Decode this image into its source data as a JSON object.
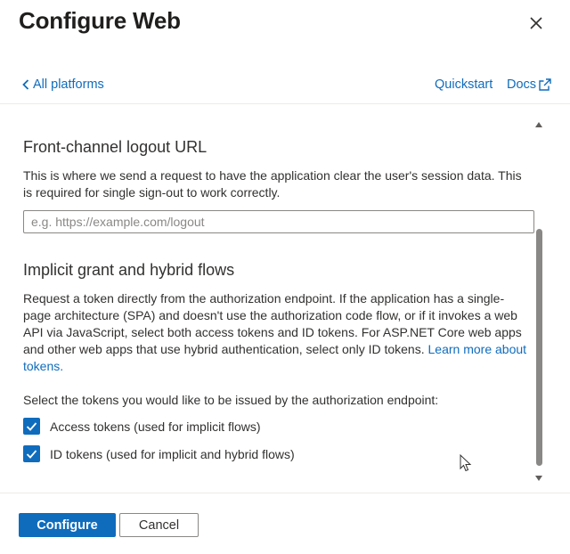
{
  "header": {
    "title": "Configure Web",
    "close_icon": "close-icon"
  },
  "nav": {
    "back_label": "All platforms",
    "quickstart_label": "Quickstart",
    "docs_label": "Docs"
  },
  "logout": {
    "title": "Front-channel logout URL",
    "description": "This is where we send a request to have the application clear the user's session data. This is required for single sign-out to work correctly.",
    "input_value": "",
    "input_placeholder": "e.g. https://example.com/logout"
  },
  "implicit": {
    "title": "Implicit grant and hybrid flows",
    "description": "Request a token directly from the authorization endpoint. If the application has a single-page architecture (SPA) and doesn't use the authorization code flow, or if it invokes a web API via JavaScript, select both access tokens and ID tokens. For ASP.NET Core web apps and other web apps that use hybrid authentication, select only ID tokens.",
    "learn_more_label": "Learn more about tokens.",
    "select_prompt": "Select the tokens you would like to be issued by the authorization endpoint:",
    "tokens": [
      {
        "label": "Access tokens (used for implicit flows)",
        "checked": true
      },
      {
        "label": "ID tokens (used for implicit and hybrid flows)",
        "checked": true
      }
    ]
  },
  "footer": {
    "configure_label": "Configure",
    "cancel_label": "Cancel"
  },
  "colors": {
    "accent": "#0f6cbd",
    "text": "#323130",
    "border": "#8a8886"
  }
}
